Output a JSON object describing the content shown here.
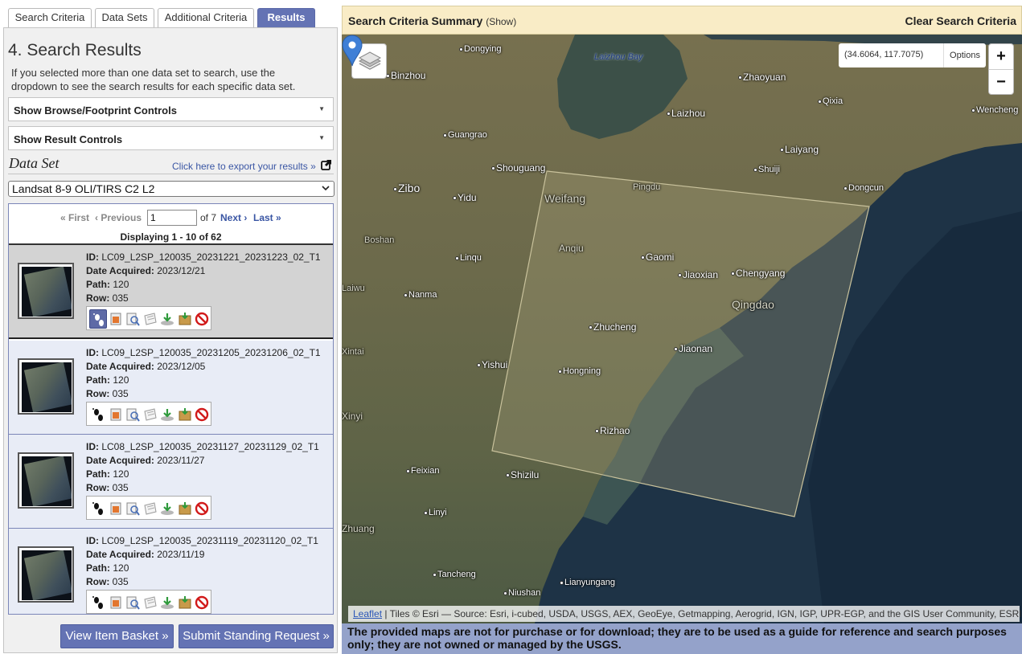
{
  "tabs": [
    {
      "label": "Search Criteria"
    },
    {
      "label": "Data Sets"
    },
    {
      "label": "Additional Criteria"
    },
    {
      "label": "Results"
    }
  ],
  "results_header": {
    "title": "4. Search Results",
    "description": "If you selected more than one data set to search, use the dropdown to see the search results for each specific data set."
  },
  "accordions": {
    "browse": "Show Browse/Footprint Controls",
    "result_controls": "Show Result Controls"
  },
  "dataset": {
    "label": "Data Set",
    "export_link": "Click here to export your results »",
    "selected": "Landsat 8-9 OLI/TIRS C2 L2"
  },
  "pager": {
    "first": "« First",
    "previous": "‹ Previous",
    "page_value": "1",
    "of_pages": "of 7",
    "next": "Next ›",
    "last": "Last »",
    "displaying": "Displaying 1 - 10 of 62"
  },
  "field_labels": {
    "id": "ID:",
    "date": "Date Acquired:",
    "path": "Path:",
    "row": "Row:"
  },
  "results": [
    {
      "id": "LC09_L2SP_120035_20231221_20231223_02_T1",
      "date": "2023/12/21",
      "path": "120",
      "row": "035",
      "selected": true
    },
    {
      "id": "LC09_L2SP_120035_20231205_20231206_02_T1",
      "date": "2023/12/05",
      "path": "120",
      "row": "035",
      "selected": false
    },
    {
      "id": "LC08_L2SP_120035_20231127_20231129_02_T1",
      "date": "2023/11/27",
      "path": "120",
      "row": "035",
      "selected": false
    },
    {
      "id": "LC09_L2SP_120035_20231119_20231120_02_T1",
      "date": "2023/11/19",
      "path": "120",
      "row": "035",
      "selected": false
    }
  ],
  "result_icons": [
    "footprint-icon",
    "overlay-icon",
    "metadata-icon",
    "compare-icon",
    "download-icon",
    "bulk-download-icon",
    "exclude-icon"
  ],
  "buttons": {
    "view_basket": "View Item Basket »",
    "standing_request": "Submit Standing Request »"
  },
  "summary_bar": {
    "title": "Search Criteria Summary",
    "show": "(Show)",
    "clear": "Clear Search Criteria"
  },
  "map": {
    "coordinates": "(34.6064, 117.7075)",
    "options": "Options",
    "zoom_in": "+",
    "zoom_out": "−",
    "water_labels": [
      "Laizhou Bay"
    ],
    "places": [
      "Dongying",
      "Binzhou",
      "Zhaoyuan",
      "Qixia",
      "Wencheng",
      "Laizhou",
      "Guangrao",
      "Laiyang",
      "Shouguang",
      "Shuiji",
      "Zibo",
      "Yidu",
      "Weifang",
      "Pingdu",
      "Dongcun",
      "Boshan",
      "Anqiu",
      "Linqu",
      "Gaomi",
      "Jiaoxian",
      "Chengyang",
      "Laiwu",
      "Nanma",
      "Qingdao",
      "Zhucheng",
      "Xintai",
      "Jiaonan",
      "Yishui",
      "Hongning",
      "Xinyi",
      "Rizhao",
      "Feixian",
      "Shizilu",
      "Linyi",
      "Zhuang",
      "Tancheng",
      "Lianyungang",
      "Niushan"
    ],
    "attribution_link": "Leaflet",
    "attribution": " | Tiles © Esri — Source: Esri, i-cubed, USDA, USGS, AEX, GeoEye, Getmapping, Aerogrid, IGN, IGP, UPR-EGP, and the GIS User Community, ESRI"
  },
  "disclaimer": "The provided maps are not for purchase or for download; they are to be used as a guide for reference and search purposes only; they are not owned or managed by the USGS.",
  "colors": {
    "tab_active": "#6473b4",
    "summary_bar": "#f9ecc6",
    "disclaimer_bar": "#94a2ca",
    "footprint": "#8e8666",
    "link": "#3a56a4"
  }
}
